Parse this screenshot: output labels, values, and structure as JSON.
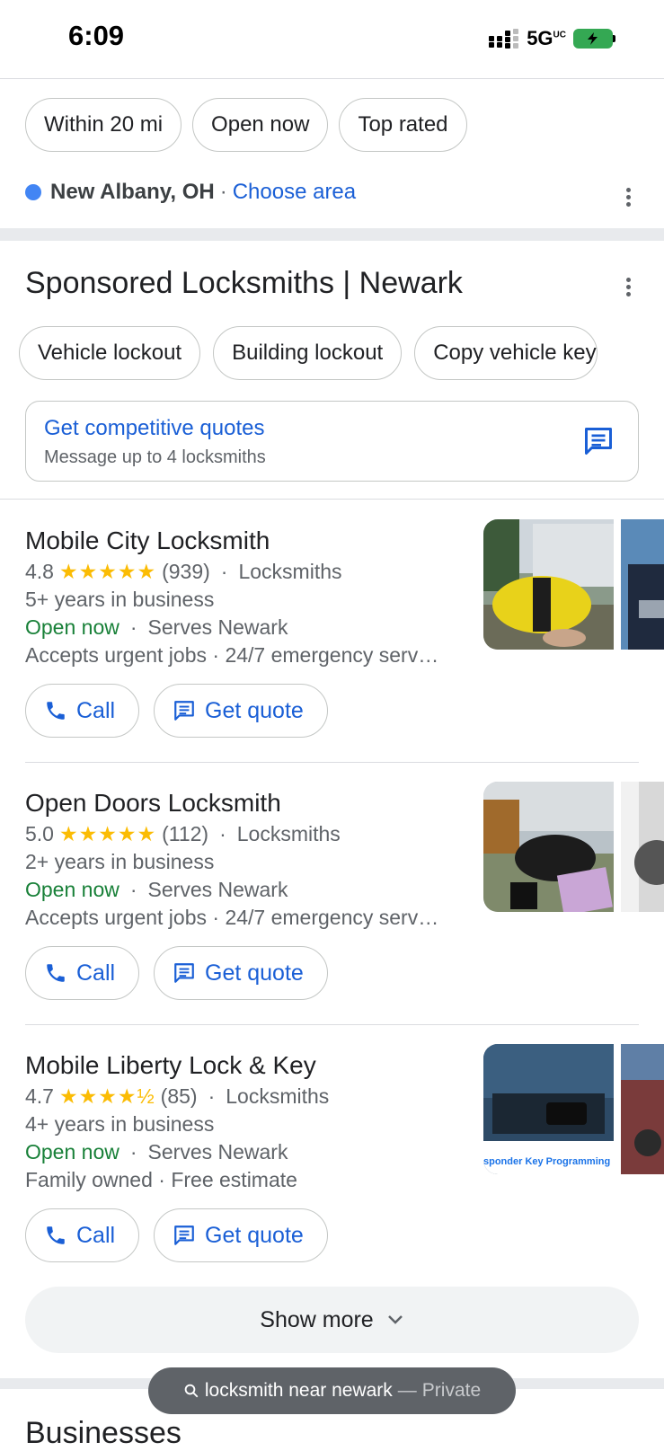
{
  "status_bar": {
    "time": "6:09",
    "network": "5G",
    "network_sub": "UC"
  },
  "filters": [
    "Within 20 mi",
    "Open now",
    "Top rated"
  ],
  "location": {
    "city": "New Albany, OH",
    "separator": "·",
    "link": "Choose area"
  },
  "sponsored": {
    "title": "Sponsored Locksmiths | Newark",
    "categories": [
      "Vehicle lockout",
      "Building lockout",
      "Copy vehicle key"
    ],
    "quote_card": {
      "title": "Get competitive quotes",
      "subtitle": "Message up to 4 locksmiths"
    }
  },
  "listings": [
    {
      "name": "Mobile City Locksmith",
      "rating": "4.8",
      "stars": "★★★★★",
      "reviews": "(939)",
      "category": "Locksmiths",
      "years": "5+ years in business",
      "open": "Open now",
      "serves": "Serves Newark",
      "extra": "Accepts urgent jobs · 24/7 emergency serv…",
      "call": "Call",
      "quote": "Get quote"
    },
    {
      "name": "Open Doors Locksmith",
      "rating": "5.0",
      "stars": "★★★★★",
      "reviews": "(112)",
      "category": "Locksmiths",
      "years": "2+ years in business",
      "open": "Open now",
      "serves": "Serves Newark",
      "extra": "Accepts urgent jobs · 24/7 emergency serv…",
      "call": "Call",
      "quote": "Get quote"
    },
    {
      "name": "Mobile Liberty Lock & Key",
      "rating": "4.7",
      "stars": "★★★★½",
      "reviews": "(85)",
      "category": "Locksmiths",
      "years": "4+ years in business",
      "open": "Open now",
      "serves": "Serves Newark",
      "extra": "Family owned · Free estimate",
      "call": "Call",
      "quote": "Get quote",
      "image_caption": "sponder Key Programming"
    }
  ],
  "show_more": "Show more",
  "next_section_title": "Businesses",
  "search_pill": {
    "query": "locksmith near newark",
    "dash": "—",
    "mode": "Private"
  },
  "colors": {
    "link_blue": "#1a5fd6",
    "open_green": "#188038",
    "star_yellow": "#fbbc04",
    "location_dot": "#4285f4"
  }
}
